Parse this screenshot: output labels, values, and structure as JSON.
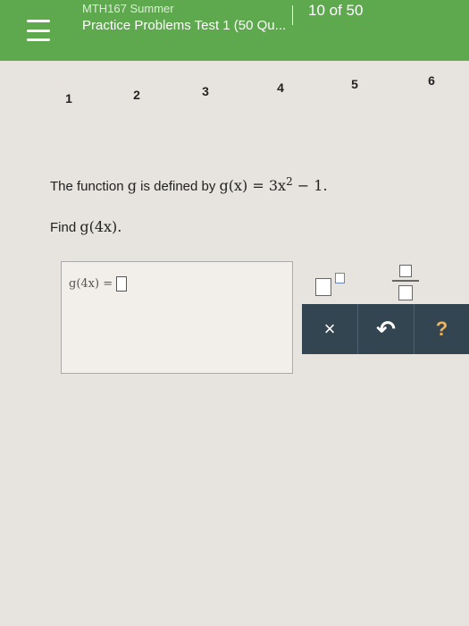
{
  "header": {
    "course": "MTH167 Summer",
    "assignment_title": "Practice Problems Test 1 (50 Qu...",
    "progress": "10 of 50"
  },
  "question_nav": {
    "items": [
      "1",
      "2",
      "3",
      "4",
      "5",
      "6"
    ]
  },
  "question": {
    "text_prefix": "The function ",
    "g": "g",
    "text_mid": " is defined by ",
    "definition_lhs": "g(x) = 3x",
    "exponent": "2",
    "definition_rhs": " − 1.",
    "find_prefix": "Find ",
    "find_expr": "g(4x)."
  },
  "answer": {
    "label": "g(4x) ="
  },
  "toolpad": {
    "clear_symbol": "×",
    "undo_symbol": "↶",
    "help_symbol": "?"
  },
  "colors": {
    "header_green": "#5ea84e",
    "action_bar": "#344552"
  }
}
